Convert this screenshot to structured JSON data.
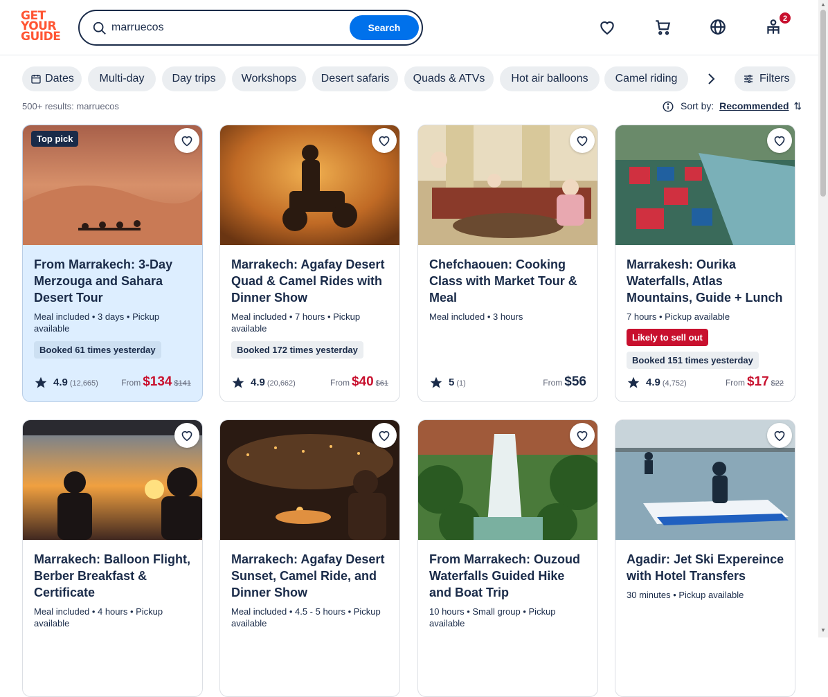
{
  "header": {
    "logo_lines": [
      "GET",
      "YOUR",
      "GUIDE"
    ],
    "search_value": "marruecos",
    "search_button": "Search",
    "icons": [
      "heart-icon",
      "cart-icon",
      "globe-icon",
      "profile-icon"
    ],
    "notification_count": "2"
  },
  "chips": [
    "Dates",
    "Multi-day",
    "Day trips",
    "Workshops",
    "Desert safaris",
    "Quads & ATVs",
    "Hot air balloons",
    "Camel riding"
  ],
  "filters_label": "Filters",
  "results_text": "500+ results: marruecos",
  "sort": {
    "label": "Sort by:",
    "value": "Recommended"
  },
  "cards": [
    {
      "badge": "Top pick",
      "title": "From Marrakech: 3-Day Merzouga and Sahara Desert Tour",
      "meta": "Meal included • 3 days • Pickup available",
      "tag": "Booked 61 times yesterday",
      "rating": "4.9",
      "reviews": "(12,665)",
      "from": "From",
      "price": "$134",
      "old_price": "$141"
    },
    {
      "title": "Marrakech: Agafay Desert Quad & Camel Rides with Dinner Show",
      "meta": "Meal included • 7 hours • Pickup available",
      "tag": "Booked 172 times yesterday",
      "rating": "4.9",
      "reviews": "(20,662)",
      "from": "From",
      "price": "$40",
      "old_price": "$61"
    },
    {
      "title": "Chefchaouen: Cooking Class with Market Tour & Meal",
      "meta": "Meal included • 3 hours",
      "rating": "5",
      "reviews": "(1)",
      "from": "From",
      "price": "$56"
    },
    {
      "title": "Marrakesh: Ourika Waterfalls, Atlas Mountains, Guide + Lunch",
      "meta": "7 hours • Pickup available",
      "sellout": "Likely to sell out",
      "tag": "Booked 151 times yesterday",
      "rating": "4.9",
      "reviews": "(4,752)",
      "from": "From",
      "price": "$17",
      "old_price": "$22"
    },
    {
      "title": "Marrakech: Balloon Flight, Berber Breakfast & Certificate",
      "meta": "Meal included • 4 hours • Pickup available"
    },
    {
      "title": "Marrakech: Agafay Desert Sunset, Camel Ride, and Dinner Show",
      "meta": "Meal included • 4.5 - 5 hours • Pickup available"
    },
    {
      "title": "From Marrakech: Ouzoud Waterfalls Guided Hike and Boat Trip",
      "meta": "10 hours • Small group • Pickup available"
    },
    {
      "title": "Agadir: Jet Ski Expereince with Hotel Transfers",
      "meta": "30 minutes • Pickup available"
    }
  ],
  "colors": {
    "accent": "#0071eb",
    "brand": "#ff5533",
    "price": "#c8102e",
    "text": "#1a2b49"
  }
}
